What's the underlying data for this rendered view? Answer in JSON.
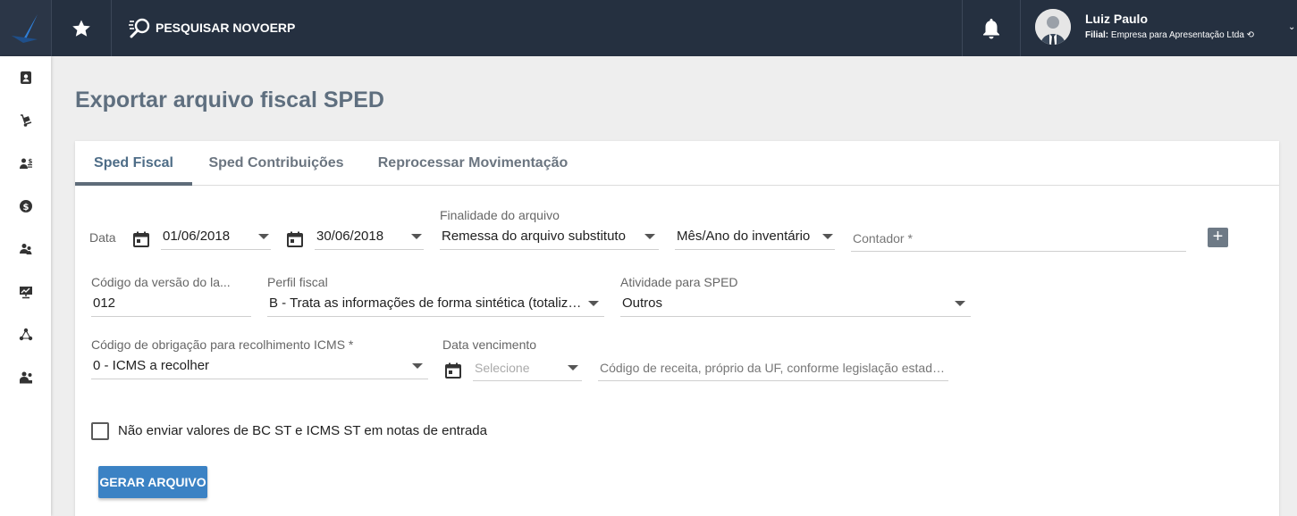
{
  "topbar": {
    "search_label": "PESQUISAR NOVOERP",
    "user_name": "Luiz Paulo",
    "filial_prefix": "Filial:",
    "filial_name": "Empresa para Apresentação Ltda"
  },
  "page": {
    "title": "Exportar arquivo fiscal SPED"
  },
  "tabs": [
    {
      "label": "Sped Fiscal"
    },
    {
      "label": "Sped Contribuições"
    },
    {
      "label": "Reprocessar Movimentação"
    }
  ],
  "form": {
    "data_label": "Data",
    "date_start": "01/06/2018",
    "date_end": "30/06/2018",
    "finalidade_label": "Finalidade do arquivo",
    "finalidade_value": "Remessa do arquivo substituto",
    "inventario_label": "Mês/Ano do inventário",
    "contador_label": "Contador *",
    "codigo_versao_label": "Código da versão do la...",
    "codigo_versao_value": "012",
    "perfil_label": "Perfil fiscal",
    "perfil_value": "B - Trata as informações de forma sintética (totalizaçõ...",
    "atividade_label": "Atividade para SPED",
    "atividade_value": "Outros",
    "obrigacao_label": "Código de obrigação para recolhimento ICMS *",
    "obrigacao_value": "0 - ICMS a recolher",
    "vencimento_label": "Data vencimento",
    "vencimento_placeholder": "Selecione",
    "receita_placeholder": "Código de receita, próprio da UF, conforme legislação estadual.",
    "checkbox_label": "Não enviar valores de BC ST e ICMS ST em notas de entrada",
    "submit_label": "GERAR ARQUIVO"
  },
  "colors": {
    "topbar": "#253040",
    "accent": "#3b82c4",
    "title": "#5f6f7f",
    "logo_check": "#2f7fd8"
  },
  "icons": {
    "logo": "checkmark-logo-icon",
    "favorites": "star-icon",
    "search": "search-icon",
    "notifications": "bell-icon",
    "sidebar": [
      "contacts-icon",
      "hand-truck-icon",
      "person-money-icon",
      "dollar-icon",
      "people-icon",
      "presentation-icon",
      "share-icon",
      "support-icon"
    ]
  }
}
